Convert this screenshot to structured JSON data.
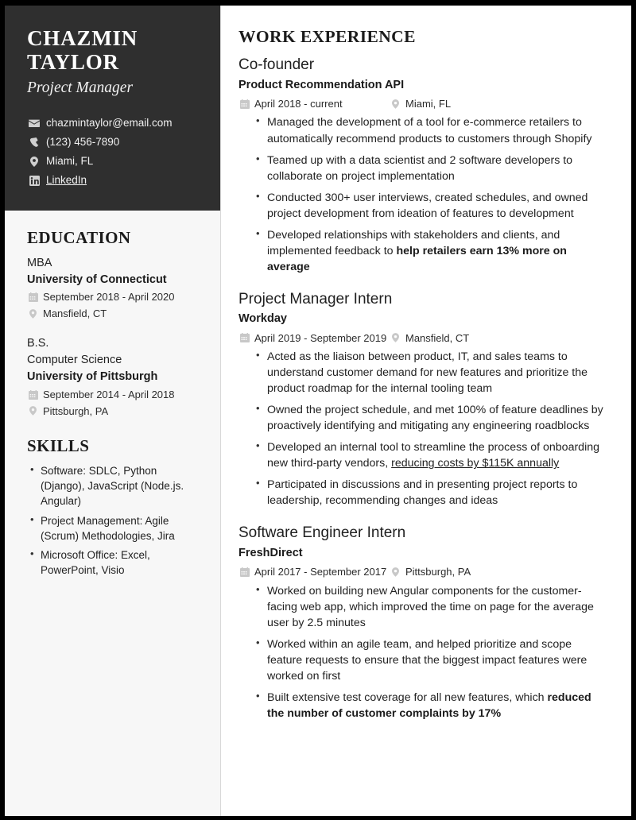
{
  "sidebar": {
    "name_line1": "CHAZMIN",
    "name_line2": "TAYLOR",
    "role": "Project Manager",
    "contacts": [
      {
        "icon": "envelope-icon",
        "text": "chazmintaylor@email.com",
        "link": false
      },
      {
        "icon": "phone-icon",
        "text": "(123) 456-7890",
        "link": false
      },
      {
        "icon": "location-pin-icon",
        "text": "Miami, FL",
        "link": false
      },
      {
        "icon": "linkedin-icon",
        "text": "LinkedIn",
        "link": true
      }
    ],
    "education_heading": "EDUCATION",
    "education": [
      {
        "degree": "MBA",
        "field": "",
        "school": "University of Connecticut",
        "dates": "September 2018 - April 2020",
        "location": "Mansfield, CT"
      },
      {
        "degree": "B.S.",
        "field": "Computer Science",
        "school": "University of Pittsburgh",
        "dates": "September 2014 - April 2018",
        "location": "Pittsburgh, PA"
      }
    ],
    "skills_heading": "SKILLS",
    "skills": [
      "Software: SDLC, Python (Django), JavaScript (Node.js. Angular)",
      "Project Management: Agile (Scrum) Methodologies, Jira",
      "Microsoft Office: Excel, PowerPoint, Visio"
    ]
  },
  "main": {
    "heading": "WORK EXPERIENCE",
    "jobs": [
      {
        "title": "Co-founder",
        "company": "Product Recommendation API",
        "dates": "April 2018 - current",
        "location": "Miami, FL",
        "bullets": [
          {
            "text": "Managed the development of a tool for e-commerce retailers to automatically recommend products to customers through Shopify"
          },
          {
            "text": "Teamed up with a data scientist and 2 software developers to collaborate on project implementation"
          },
          {
            "text": "Conducted 300+ user interviews, created schedules, and owned project development from ideation of features to development"
          },
          {
            "text": "Developed relationships with stakeholders and clients, and implemented feedback to ",
            "bold": "help retailers earn 13% more on average"
          }
        ]
      },
      {
        "title": "Project Manager Intern",
        "company": "Workday",
        "dates": "April 2019 - September 2019",
        "location": "Mansfield, CT",
        "bullets": [
          {
            "text": "Acted as the liaison between product, IT, and sales teams to understand customer demand for new features and prioritize the product roadmap for the internal tooling team"
          },
          {
            "text": "Owned the project schedule, and met 100% of feature deadlines by proactively identifying and mitigating any engineering roadblocks"
          },
          {
            "text": "Developed an internal tool to streamline the process of onboarding new third-party vendors, ",
            "underline": "reducing costs by $115K annually"
          },
          {
            "text": "Participated in discussions and in presenting project reports to leadership, recommending changes and ideas"
          }
        ]
      },
      {
        "title": "Software Engineer Intern",
        "company": "FreshDirect",
        "dates": "April 2017 - September 2017",
        "location": "Pittsburgh, PA",
        "bullets": [
          {
            "text": "Worked on building new Angular components for the customer-facing web app, which improved the time on page for the average user by 2.5 minutes"
          },
          {
            "text": "Worked within an agile team, and helped prioritize and scope feature requests to ensure that the biggest impact features were worked on first"
          },
          {
            "text": "Built extensive test coverage for all new features, which ",
            "bold": "reduced the number of customer complaints by 17%"
          }
        ]
      }
    ]
  }
}
